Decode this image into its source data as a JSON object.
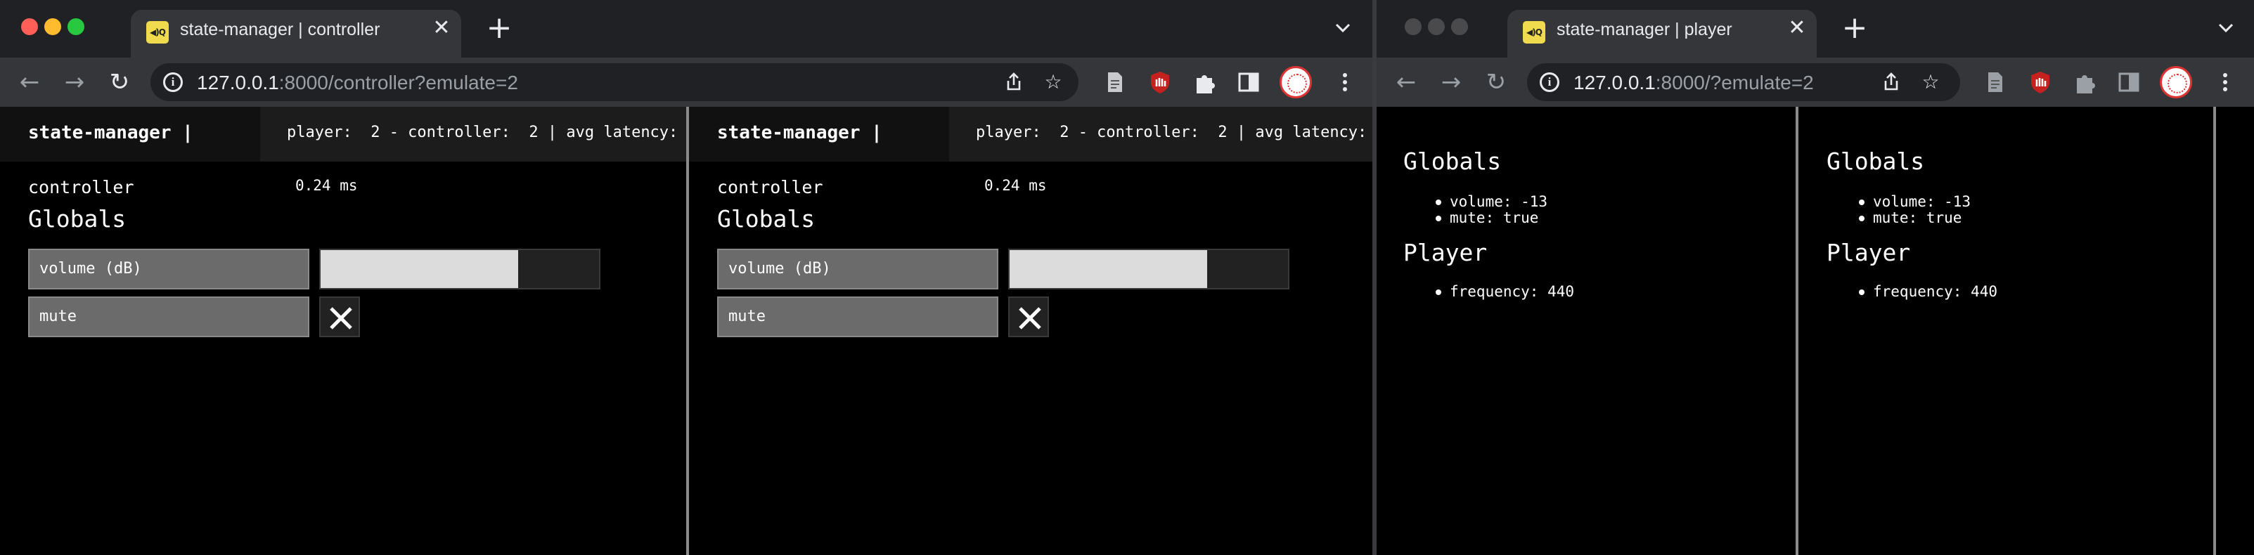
{
  "left_window": {
    "tab": {
      "title": "state-manager | controller",
      "close": "✕"
    },
    "url": {
      "host": "127.0.0.1",
      "path": ":8000/controller?emulate=2"
    },
    "panes": [
      {
        "title": "state-manager |",
        "status": "player:  2 - controller:  2 | avg latency:",
        "role": "controller",
        "latency": "0.24 ms",
        "globals_heading": "Globals",
        "volume_label": "volume (dB)",
        "volume_fraction": 0.71,
        "mute_label": "mute",
        "mute_value": true
      },
      {
        "title": "state-manager |",
        "status": "player:  2 - controller:  2 | avg latency:",
        "role": "controller",
        "latency": "0.24 ms",
        "globals_heading": "Globals",
        "volume_label": "volume (dB)",
        "volume_fraction": 0.71,
        "mute_label": "mute",
        "mute_value": true
      }
    ]
  },
  "right_window": {
    "tab": {
      "title": "state-manager | player",
      "close": "✕"
    },
    "url": {
      "host": "127.0.0.1",
      "path": ":8000/?emulate=2"
    },
    "panes": [
      {
        "globals_heading": "Globals",
        "globals": [
          "volume: -13",
          "mute: true"
        ],
        "player_heading": "Player",
        "player": [
          "frequency: 440"
        ]
      },
      {
        "globals_heading": "Globals",
        "globals": [
          "volume: -13",
          "mute: true"
        ],
        "player_heading": "Player",
        "player": [
          "frequency: 440"
        ]
      }
    ]
  },
  "browser": {
    "new_tab": "+",
    "traffic_colors": {
      "close": "#ff5f57",
      "minimize": "#febc2e",
      "maximize": "#28c840",
      "inactive": "#4a4a4d"
    },
    "favicon_text": "◀)Q",
    "icons": [
      "back-icon",
      "forward-icon",
      "reload-icon",
      "info-icon",
      "share-icon",
      "star-icon",
      "document-icon",
      "ublock-icon",
      "puzzle-icon",
      "side-panel-icon",
      "avatar",
      "menu-icon"
    ]
  }
}
